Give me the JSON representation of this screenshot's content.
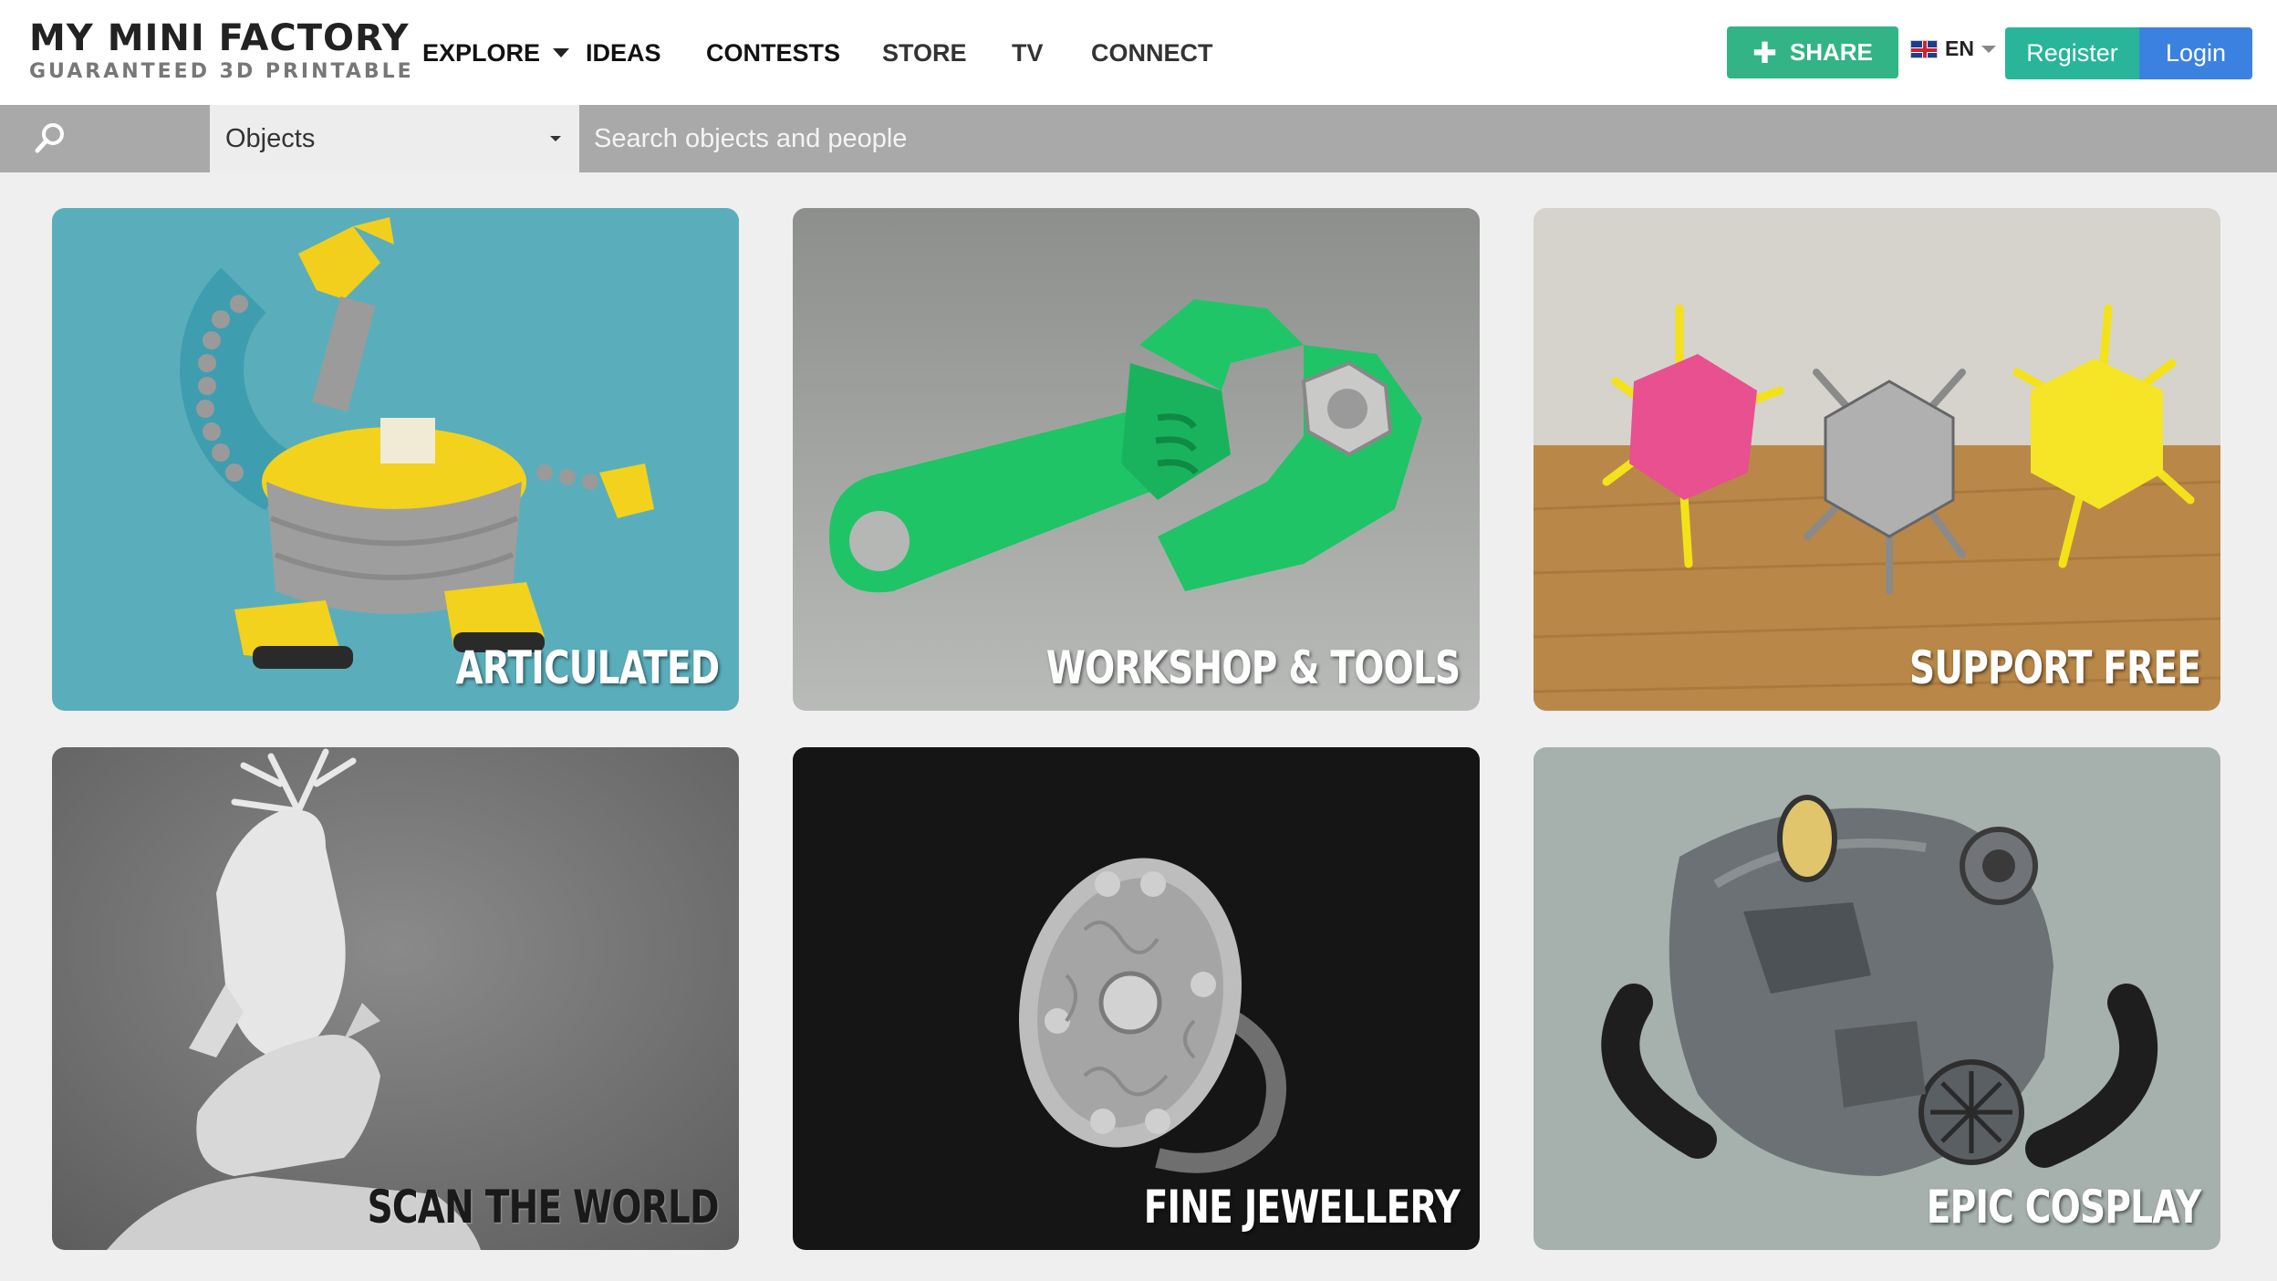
{
  "brand": {
    "title": "MY MINI FACTORY",
    "tagline": "GUARANTEED 3D PRINTABLE"
  },
  "nav": {
    "explore": "EXPLORE",
    "ideas": "IDEAS",
    "contests": "CONTESTS",
    "store": "STORE",
    "tv": "TV",
    "connect": "CONNECT"
  },
  "actions": {
    "share_icon": "plus-icon",
    "share": "SHARE",
    "language": "EN",
    "language_flag": "uk-flag-icon",
    "register": "Register",
    "login": "Login"
  },
  "search": {
    "icon": "search-icon",
    "type_selected": "Objects",
    "placeholder": "Search objects and people"
  },
  "categories": [
    {
      "label": "ARTICULATED",
      "bg": "#5aaebb"
    },
    {
      "label": "WORKSHOP & TOOLS",
      "bg": "#9a9c9a"
    },
    {
      "label": "SUPPORT FREE",
      "bg": "#c8a06a"
    },
    {
      "label": "SCAN THE WORLD",
      "bg": "#7a7a7a"
    },
    {
      "label": "FINE JEWELLERY",
      "bg": "#151515"
    },
    {
      "label": "EPIC COSPLAY",
      "bg": "#a6b0ad"
    }
  ],
  "colors": {
    "share_green": "#32b486",
    "register_teal": "#28b59a",
    "login_blue": "#3b82e0",
    "searchbar_gray": "#a9a9a9"
  }
}
